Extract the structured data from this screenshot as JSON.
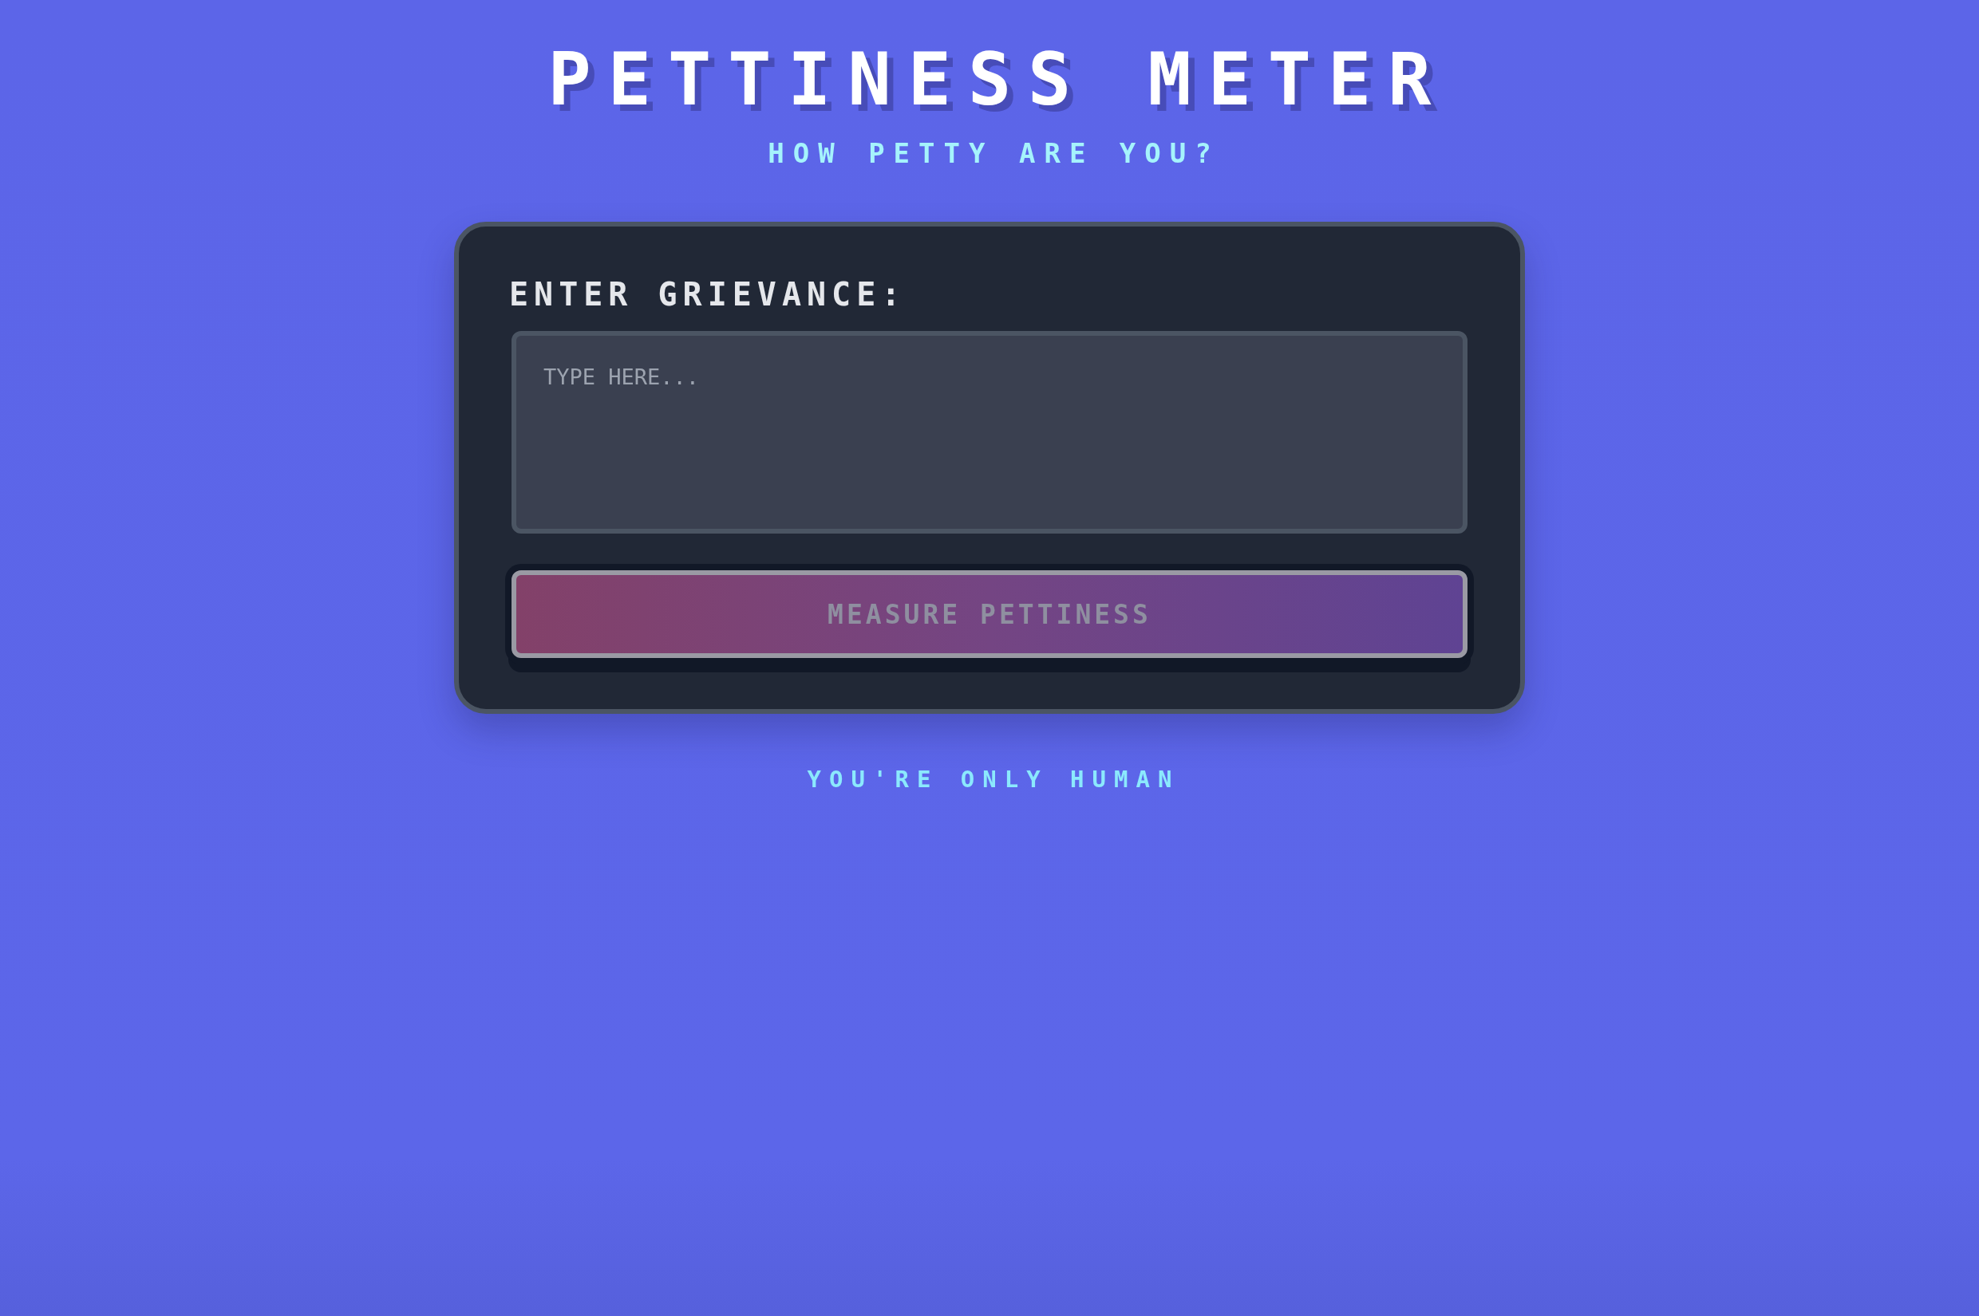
{
  "header": {
    "title": "PETTINESS METER",
    "subtitle": "HOW PETTY ARE YOU?"
  },
  "form": {
    "label": "ENTER GRIEVANCE:",
    "grievance_field": {
      "placeholder": "TYPE HERE..."
    },
    "submit_button": {
      "label": "MEASURE PETTINESS",
      "disabled": true
    }
  },
  "footer": {
    "text": "YOU'RE ONLY HUMAN"
  }
}
